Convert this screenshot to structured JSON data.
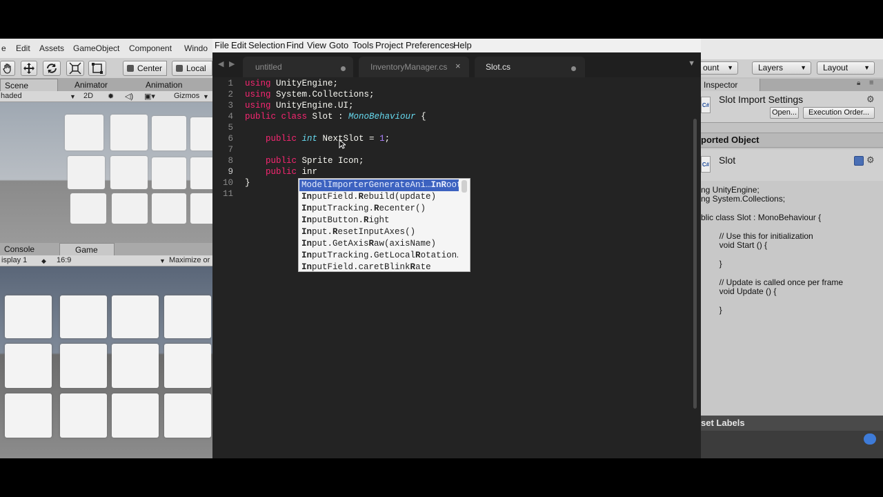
{
  "unity_left": {
    "menu": [
      "e",
      "Edit",
      "Assets",
      "GameObject",
      "Component",
      "Windo"
    ],
    "toolbar": {
      "pivot": "Center",
      "space": "Local"
    },
    "scene_tabs": [
      "Scene",
      "Animator",
      "Animation"
    ],
    "scene_options": {
      "shading": "haded",
      "mode_2d": "2D",
      "gizmos": "Gizmos"
    },
    "game_tabs": [
      "Console",
      "Game"
    ],
    "game_options": {
      "display": "isplay 1",
      "aspect": "16:9",
      "maximize": "Maximize or"
    }
  },
  "editor": {
    "menu": [
      "File",
      "Edit",
      "Selection",
      "Find",
      "View",
      "Goto",
      "Tools",
      "Project",
      "Preferences",
      "Help"
    ],
    "tabs": [
      {
        "label": "untitled",
        "state": "modified"
      },
      {
        "label": "InventoryManager.cs",
        "state": "close"
      },
      {
        "label": "Slot.cs",
        "state": "modified",
        "active": true
      }
    ],
    "line_numbers": [
      "1",
      "2",
      "3",
      "4",
      "5",
      "6",
      "7",
      "8",
      "9",
      "10",
      "11"
    ],
    "code": {
      "l1_kw": "using",
      "l1_rest": " UnityEngine;",
      "l2_kw": "using",
      "l2_rest": " System.Collections;",
      "l3_kw": "using",
      "l3_rest": " UnityEngine.UI;",
      "l4_kw": "public class",
      "l4_mid": " Slot : ",
      "l4_type": "MonoBehaviour",
      "l4_end": " {",
      "l6_kw": "public",
      "l6_type": "int",
      "l6_mid": " NextSlot = ",
      "l6_num": "1",
      "l6_end": ";",
      "l8_kw": "public",
      "l8_rest": " Sprite Icon;",
      "l9_kw": "public",
      "l9_rest": " inr",
      "l10": "}"
    },
    "autocomplete": [
      {
        "pre": "ModelImporterGenerateAni…",
        "bold": "InR",
        "post": "oot"
      },
      {
        "pre": "",
        "bold": "In",
        "post": "putField.",
        "bold2": "R",
        "post2": "ebuild(update)"
      },
      {
        "pre": "",
        "bold": "In",
        "post": "putTracking.",
        "bold2": "R",
        "post2": "ecenter()"
      },
      {
        "pre": "",
        "bold": "In",
        "post": "putButton.",
        "bold2": "R",
        "post2": "ight"
      },
      {
        "pre": "",
        "bold": "In",
        "post": "put.",
        "bold2": "R",
        "post2": "esetInputAxes()"
      },
      {
        "pre": "",
        "bold": "In",
        "post": "put.GetAxis",
        "bold2": "R",
        "post2": "aw(axisName)"
      },
      {
        "pre": "",
        "bold": "In",
        "post": "putTracking.GetLocal",
        "bold2": "R",
        "post2": "otation…"
      },
      {
        "pre": "",
        "bold": "In",
        "post": "putField.caretBlink",
        "bold2": "R",
        "post2": "ate"
      }
    ]
  },
  "unity_right": {
    "toolbar": {
      "layers_prefix": "ount",
      "layers": "Layers",
      "layout": "Layout"
    },
    "inspector_tab": "Inspector",
    "import_settings_title": "Slot Import Settings",
    "open_button": "Open...",
    "execution_order_button": "Execution Order...",
    "imported_object_header": "ported Object",
    "object_name": "Slot",
    "preview_lines": [
      "ng UnityEngine;",
      "ng System.Collections;",
      "",
      "blic class Slot : MonoBehaviour {",
      "",
      "        // Use this for initialization",
      "        void Start () {",
      "",
      "        }",
      "",
      "        // Update is called once per frame",
      "        void Update () {",
      "",
      "        }"
    ],
    "asset_labels": "set Labels"
  },
  "colors": {
    "editor_bg": "#232323",
    "keyword": "#f92672",
    "type": "#66d9ef",
    "number": "#ae81ff",
    "autocomplete_selected": "#3c62c0"
  }
}
